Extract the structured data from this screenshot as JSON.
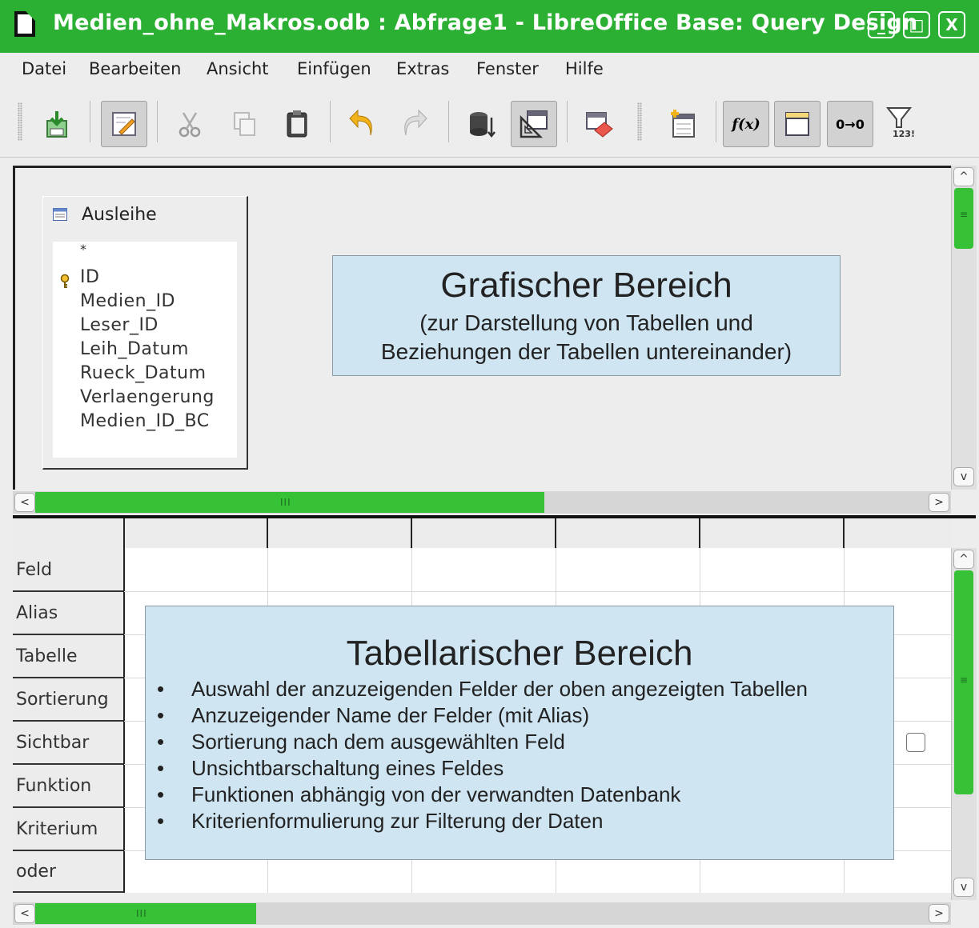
{
  "window": {
    "title": "Medien_ohne_Makros.odb : Abfrage1 - LibreOffice Base: Query Design",
    "controls": {
      "minimize": "_",
      "maximize": "□",
      "close": "X"
    }
  },
  "menu": [
    "Datei",
    "Bearbeiten",
    "Ansicht",
    "Einfügen",
    "Extras",
    "Fenster",
    "Hilfe"
  ],
  "toolbar": {
    "icons": [
      "save-icon",
      "edit-mode-icon",
      "cut-icon",
      "copy-icon",
      "paste-icon",
      "undo-icon",
      "redo-icon",
      "run-query-icon",
      "design-view-icon",
      "add-table-icon",
      "clear-query-icon",
      "add-tables-icon",
      "functions-icon",
      "table-name-icon",
      "alias-icon",
      "distinct-values-icon"
    ],
    "functions_label": "f(x)",
    "alias_label": "0→0",
    "limit_label": "123!"
  },
  "graphic_area": {
    "table": {
      "title": "Ausleihe",
      "fields": [
        "*",
        "ID",
        "Medien_ID",
        "Leser_ID",
        "Leih_Datum",
        "Rueck_Datum",
        "Verlaengerung",
        "Medien_ID_BC"
      ]
    },
    "callout": {
      "title": "Grafischer Bereich",
      "line1": "(zur Darstellung von Tabellen und",
      "line2": "Beziehungen der Tabellen untereinander)"
    }
  },
  "grid": {
    "row_labels": [
      "Feld",
      "Alias",
      "Tabelle",
      "Sortierung",
      "Sichtbar",
      "Funktion",
      "Kriterium",
      "oder"
    ],
    "callout": {
      "title": "Tabellarischer Bereich",
      "bullet_char": "•",
      "bullets": [
        "Auswahl der anzuzeigenden Felder der oben angezeigten Tabellen",
        "Anzuzeigender Name der Felder (mit Alias)",
        "Sortierung nach dem ausgewählten Feld",
        "Unsichtbarschaltung eines Feldes",
        "Funktionen abhängig von der verwandten Datenbank",
        "Kriterienformulierung zur Filterung der Daten"
      ]
    }
  },
  "scrollbars": {
    "grip": "III",
    "left": "<",
    "right": ">",
    "up": "^",
    "down": "v",
    "v_grip": "≡"
  },
  "colors": {
    "titlebar": "#2bb033",
    "scroll_thumb": "#36c137",
    "callout_bg": "#cfe5f2"
  }
}
